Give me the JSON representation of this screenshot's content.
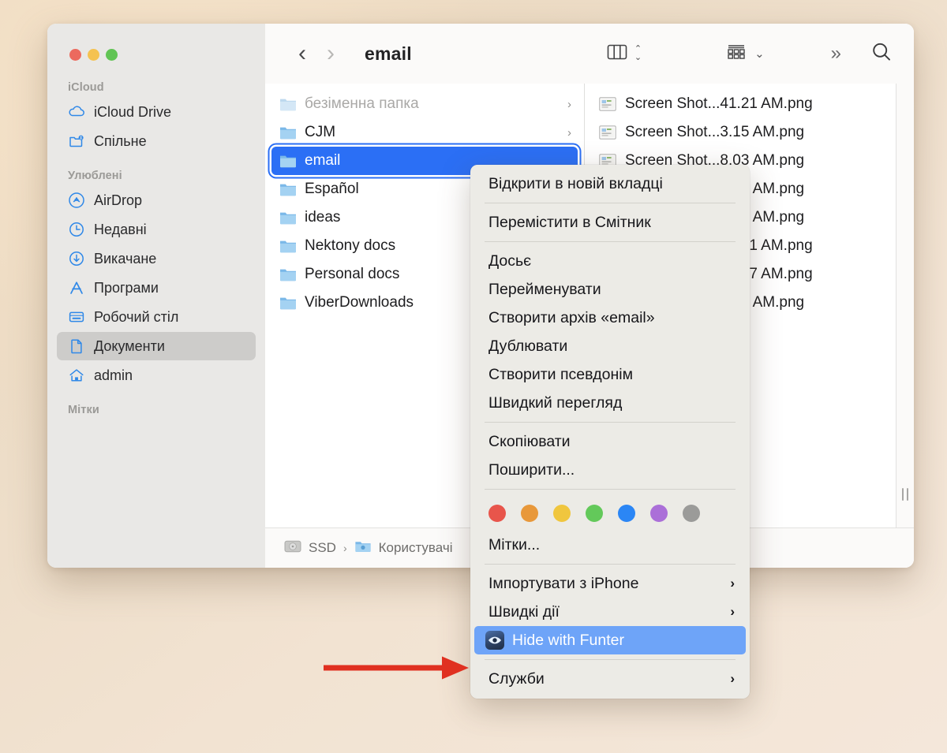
{
  "window": {
    "title": "email",
    "traffic_lights": [
      "close",
      "minimize",
      "zoom"
    ]
  },
  "toolbar": {
    "back_label": "‹",
    "forward_label": "›",
    "title": "email",
    "view_icon": "column-view-icon",
    "view_stepper_up": "⌃",
    "view_stepper_down": "⌄",
    "group_icon": "group-by-icon",
    "group_caret": "⌄",
    "more_label": "»",
    "search_icon": "search-icon"
  },
  "sidebar": {
    "sections": [
      {
        "title": "iCloud",
        "items": [
          {
            "label": "iCloud Drive",
            "icon": "cloud-icon",
            "selected": false
          },
          {
            "label": "Спільне",
            "icon": "shared-folder-icon",
            "selected": false
          }
        ]
      },
      {
        "title": "Улюблені",
        "items": [
          {
            "label": "AirDrop",
            "icon": "airdrop-icon",
            "selected": false
          },
          {
            "label": "Недавні",
            "icon": "clock-icon",
            "selected": false
          },
          {
            "label": "Викачане",
            "icon": "download-icon",
            "selected": false
          },
          {
            "label": "Програми",
            "icon": "applications-icon",
            "selected": false
          },
          {
            "label": "Робочий стіл",
            "icon": "desktop-icon",
            "selected": false
          },
          {
            "label": "Документи",
            "icon": "document-icon",
            "selected": true
          },
          {
            "label": "admin",
            "icon": "home-icon",
            "selected": false
          }
        ]
      },
      {
        "title": "Мітки",
        "items": []
      }
    ]
  },
  "folder_column": {
    "rows": [
      {
        "name": "безіменна папка",
        "dimmed": true,
        "selected": false,
        "arrow": "›"
      },
      {
        "name": "CJM",
        "dimmed": false,
        "selected": false,
        "arrow": "›"
      },
      {
        "name": "email",
        "dimmed": false,
        "selected": true,
        "arrow": ""
      },
      {
        "name": "Español",
        "dimmed": false,
        "selected": false,
        "arrow": ""
      },
      {
        "name": "ideas",
        "dimmed": false,
        "selected": false,
        "arrow": ""
      },
      {
        "name": "Nektony docs",
        "dimmed": false,
        "selected": false,
        "arrow": ""
      },
      {
        "name": "Personal docs",
        "dimmed": false,
        "selected": false,
        "arrow": ""
      },
      {
        "name": "ViberDownloads",
        "dimmed": false,
        "selected": false,
        "arrow": ""
      }
    ]
  },
  "file_column": {
    "rows": [
      {
        "name": "Screen Shot...41.21 AM.png",
        "icon": "png-preview-icon"
      },
      {
        "name": "Screen Shot...3.15 AM.png",
        "icon": "png-preview-icon"
      },
      {
        "name": "Screen Shot...8.03 AM.png",
        "icon": "png-preview-icon"
      },
      {
        "name": "Screen Shot...0.34 AM.png",
        "icon": "png-preview-icon"
      },
      {
        "name": "Screen Shot...5.33 AM.png",
        "icon": "png-preview-icon"
      },
      {
        "name": "Screen Shot...07.21 AM.png",
        "icon": "png-preview-icon"
      },
      {
        "name": "Screen Shot...09.17 AM.png",
        "icon": "png-preview-icon"
      },
      {
        "name": "Screen Shot...0.54 AM.png",
        "icon": "png-preview-icon"
      }
    ]
  },
  "pathbar": {
    "crumbs": [
      {
        "label": "SSD",
        "icon": "hard-drive-icon"
      },
      {
        "label": "Користувачі",
        "icon": "users-folder-icon"
      }
    ],
    "separator": "›"
  },
  "context_menu": {
    "items": [
      {
        "type": "item",
        "label": "Відкрити в новій вкладці",
        "arrow": "",
        "highlighted": false
      },
      {
        "type": "separator"
      },
      {
        "type": "item",
        "label": "Перемістити в Смітник",
        "arrow": "",
        "highlighted": false
      },
      {
        "type": "separator"
      },
      {
        "type": "item",
        "label": "Досьє",
        "arrow": "",
        "highlighted": false
      },
      {
        "type": "item",
        "label": "Перейменувати",
        "arrow": "",
        "highlighted": false
      },
      {
        "type": "item",
        "label": "Створити архів «email»",
        "arrow": "",
        "highlighted": false
      },
      {
        "type": "item",
        "label": "Дублювати",
        "arrow": "",
        "highlighted": false
      },
      {
        "type": "item",
        "label": "Створити псевдонім",
        "arrow": "",
        "highlighted": false
      },
      {
        "type": "item",
        "label": "Швидкий перегляд",
        "arrow": "",
        "highlighted": false
      },
      {
        "type": "separator"
      },
      {
        "type": "item",
        "label": "Скопіювати",
        "arrow": "",
        "highlighted": false
      },
      {
        "type": "item",
        "label": "Поширити...",
        "arrow": "",
        "highlighted": false
      },
      {
        "type": "separator"
      },
      {
        "type": "tags"
      },
      {
        "type": "item",
        "label": "Мітки...",
        "arrow": "",
        "highlighted": false
      },
      {
        "type": "separator"
      },
      {
        "type": "item",
        "label": "Імпортувати з iPhone",
        "arrow": "›",
        "highlighted": false
      },
      {
        "type": "item",
        "label": "Швидкі дії",
        "arrow": "›",
        "highlighted": false
      },
      {
        "type": "item",
        "label": "Hide with Funter",
        "arrow": "",
        "highlighted": true,
        "icon": "funter-eye-icon"
      },
      {
        "type": "separator"
      },
      {
        "type": "item",
        "label": "Служби",
        "arrow": "›",
        "highlighted": false
      }
    ],
    "tag_colors": [
      "#e8554b",
      "#e8983a",
      "#f0c63e",
      "#63c95a",
      "#2b86f5",
      "#ab6fd8",
      "#9b9b99"
    ],
    "highlight_color": "#6ea4f8"
  },
  "annotation": {
    "arrow_color": "#e03020",
    "arrow_name": "red-pointer-arrow"
  },
  "colors": {
    "accent_blue": "#2b6ff5",
    "sidebar_bg": "#e9e8e6",
    "menu_bg": "#ecebe6",
    "page_bg": "#ecdcc6"
  }
}
